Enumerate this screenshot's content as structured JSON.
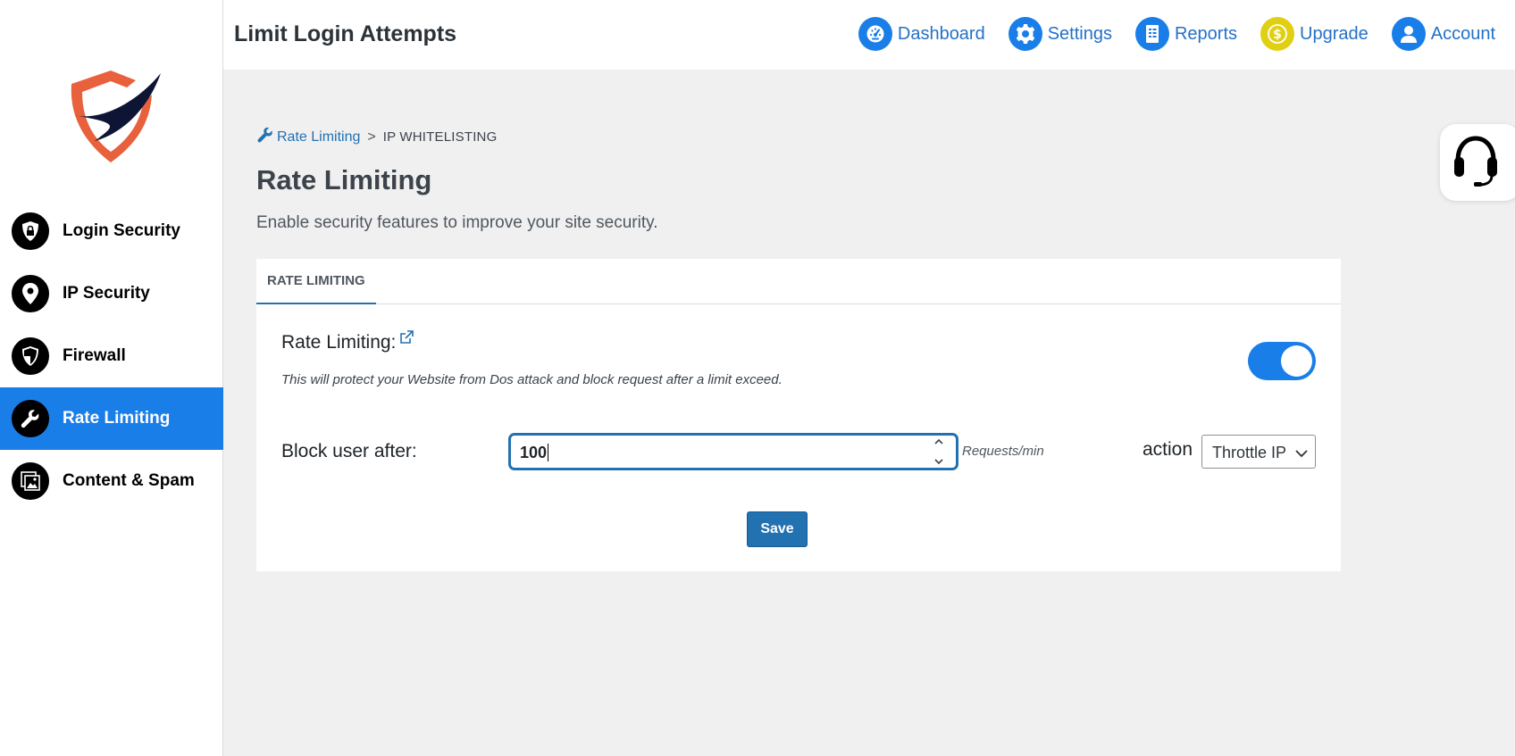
{
  "app": {
    "title": "Limit Login Attempts"
  },
  "topnav": [
    {
      "label": "Dashboard",
      "icon": "speedometer-icon"
    },
    {
      "label": "Settings",
      "icon": "gear-icon"
    },
    {
      "label": "Reports",
      "icon": "document-icon"
    },
    {
      "label": "Upgrade",
      "icon": "dollar-icon"
    },
    {
      "label": "Account",
      "icon": "user-icon"
    }
  ],
  "sidebar": {
    "logo": "shield-logo",
    "items": [
      {
        "label": "Login Security",
        "icon": "lock-shield-icon",
        "active": false
      },
      {
        "label": "IP Security",
        "icon": "location-pin-icon",
        "active": false
      },
      {
        "label": "Firewall",
        "icon": "shield-icon",
        "active": false
      },
      {
        "label": "Rate Limiting",
        "icon": "wrench-icon",
        "active": true
      },
      {
        "label": "Content & Spam",
        "icon": "image-stack-icon",
        "active": false
      }
    ]
  },
  "breadcrumb": {
    "link": "Rate Limiting",
    "separator": ">",
    "current": "IP WHITELISTING"
  },
  "page": {
    "title": "Rate Limiting",
    "description": "Enable security features to improve your site security."
  },
  "card": {
    "tab": "RATE LIMITING",
    "rate_limiting_label": "Rate Limiting:",
    "rate_limiting_help": "This will protect your Website from Dos attack and block request after a limit exceed.",
    "rate_limiting_enabled": true,
    "block_label": "Block user after:",
    "block_value": "100",
    "units": "Requests/min",
    "action_label": "action",
    "action_value": "Throttle IP",
    "save_label": "Save"
  },
  "colors": {
    "accent": "#1a7ee8",
    "link": "#2271b1",
    "upgrade": "#e0cf12",
    "logo_orange": "#e8603c",
    "logo_navy": "#0e1434"
  }
}
